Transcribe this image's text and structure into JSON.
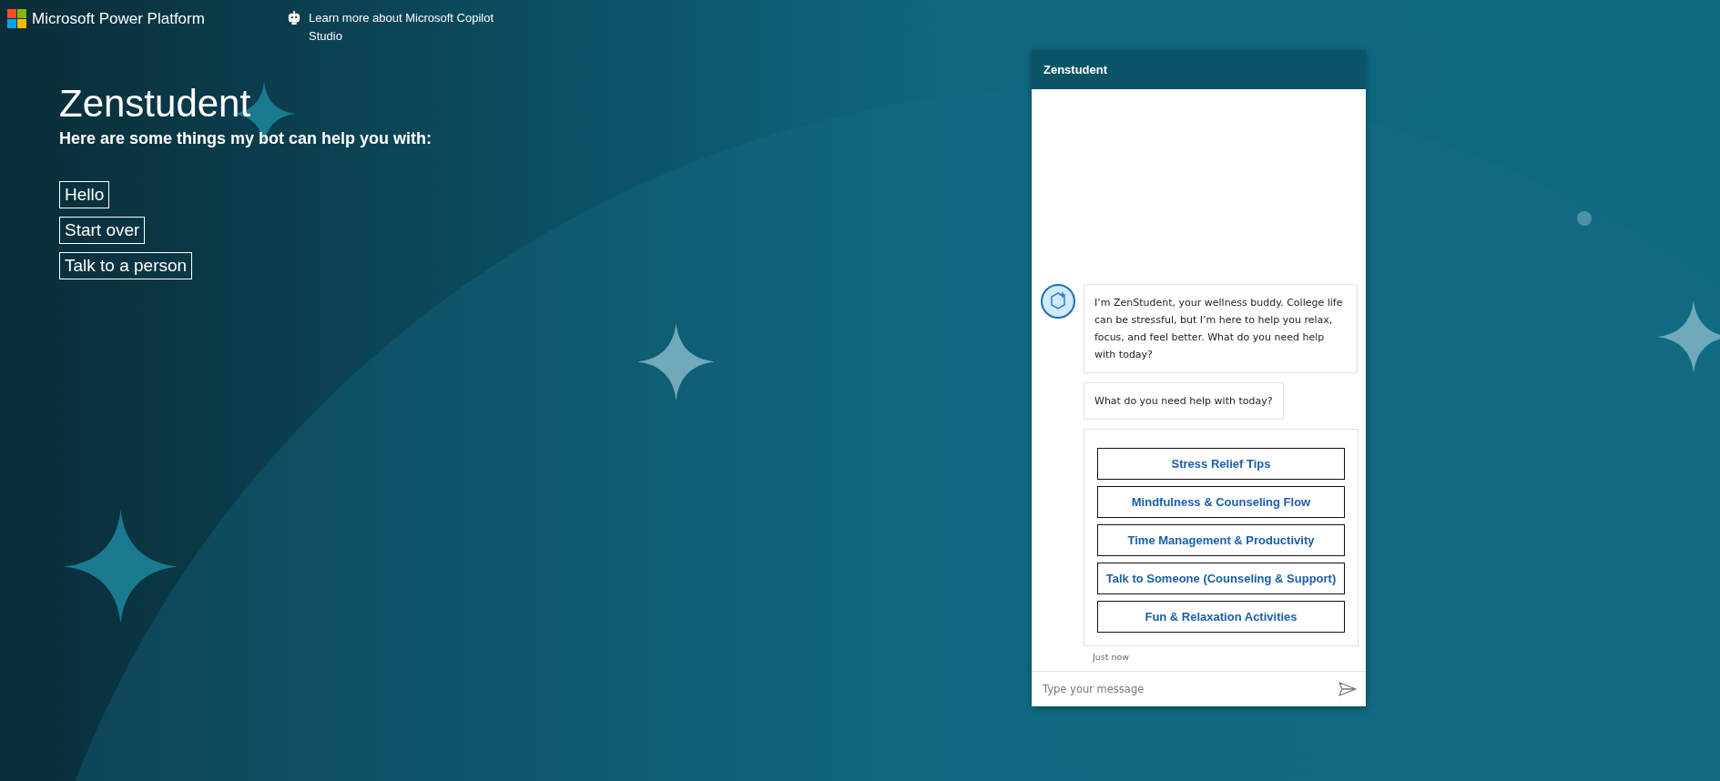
{
  "header": {
    "brand": "Microsoft Power Platform",
    "link": "Learn more about Microsoft Copilot Studio"
  },
  "bot": {
    "title": "Zenstudent",
    "subtitle": "Here are some things my bot can help you with:",
    "suggestions": [
      "Hello",
      "Start over",
      "Talk to a person"
    ]
  },
  "chat": {
    "title": "Zenstudent",
    "messages": [
      {
        "kind": "text",
        "avatar": true,
        "text": "I’m ZenStudent, your wellness buddy. College life can be stressful, but I’m here to help you relax, focus, and feel better. What do you need help with today?"
      },
      {
        "kind": "text",
        "avatar": false,
        "text": "What do you need help with today?"
      },
      {
        "kind": "actions",
        "avatar": false,
        "actions": [
          "Stress Relief Tips",
          "Mindfulness & Counseling Flow",
          "Time Management & Productivity",
          "Talk to Someone (Counseling & Support)",
          "Fun & Relaxation Activities"
        ]
      }
    ],
    "timestamp": "Just now",
    "input": {
      "placeholder": "Type your message"
    }
  }
}
